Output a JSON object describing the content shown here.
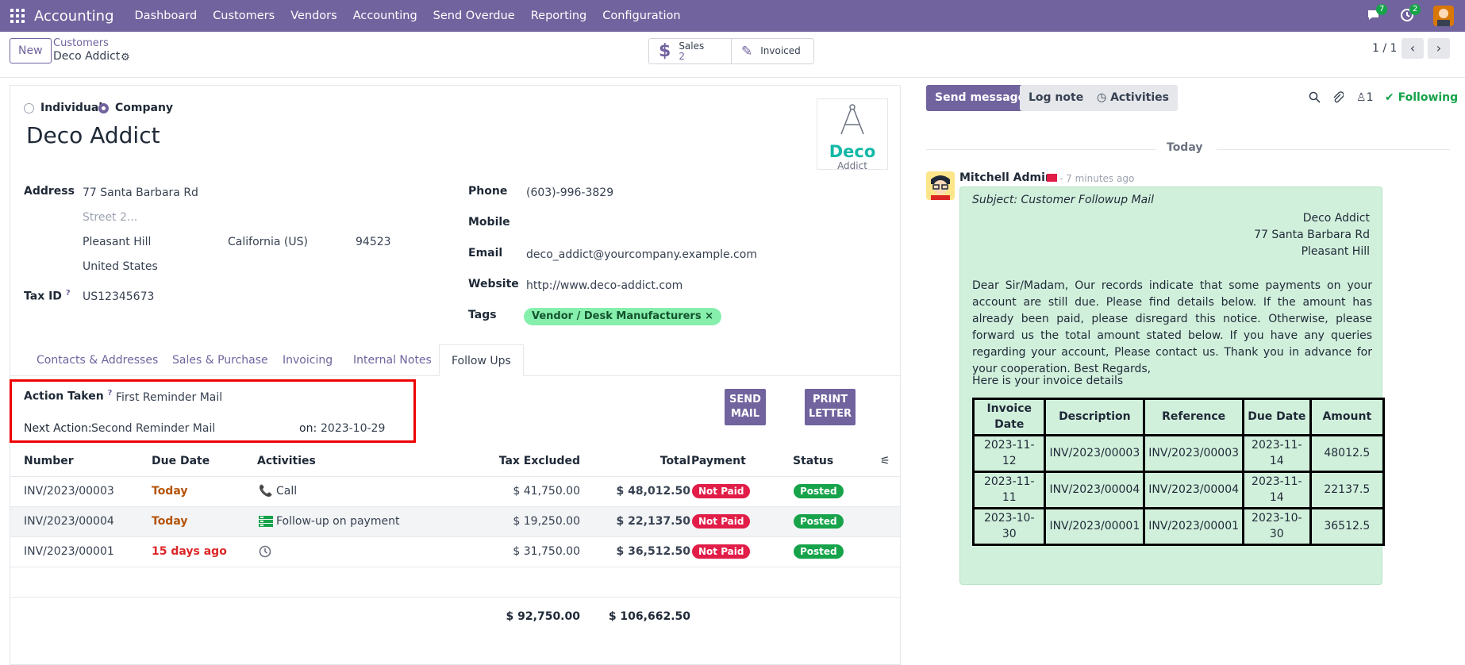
{
  "topnav": {
    "brand": "Accounting",
    "menu": [
      "Dashboard",
      "Customers",
      "Vendors",
      "Accounting",
      "Send Overdue",
      "Reporting",
      "Configuration"
    ],
    "messages_count": "7",
    "activities_count": "2"
  },
  "control_panel": {
    "new_label": "New",
    "breadcrumb_parent": "Customers",
    "breadcrumb_current": "Deco Addict",
    "sales_label": "Sales",
    "sales_count": "2",
    "invoiced_label": "Invoiced",
    "pager": "1 / 1"
  },
  "form": {
    "radio_individual": "Individual",
    "radio_company": "Company",
    "name": "Deco Addict",
    "logo_top": "Deco",
    "logo_bottom": "Addict",
    "address_label": "Address",
    "street": "77 Santa Barbara Rd",
    "street2_placeholder": "Street 2...",
    "city": "Pleasant Hill",
    "state": "California (US)",
    "zip": "94523",
    "country": "United States",
    "tax_id_label": "Tax ID",
    "tax_id": "US12345673",
    "phone_label": "Phone",
    "phone": "(603)-996-3829",
    "mobile_label": "Mobile",
    "email_label": "Email",
    "email": "deco_addict@yourcompany.example.com",
    "website_label": "Website",
    "website": "http://www.deco-addict.com",
    "tags_label": "Tags",
    "tag": "Vendor / Desk Manufacturers",
    "tabs": [
      "Contacts & Addresses",
      "Sales & Purchase",
      "Invoicing",
      "Internal Notes",
      "Follow Ups"
    ]
  },
  "followup": {
    "action_taken_label": "Action Taken",
    "action_taken": "First Reminder Mail",
    "next_action_label": "Next Action:",
    "next_action": "Second Reminder Mail",
    "on_label": "on:",
    "on_date": "2023-10-29",
    "send_mail_1": "SEND",
    "send_mail_2": "MAIL",
    "print_letter_1": "PRINT",
    "print_letter_2": "LETTER"
  },
  "invoices": {
    "headers": [
      "Number",
      "Due Date",
      "Activities",
      "Tax Excluded",
      "Total",
      "Payment",
      "Status"
    ],
    "rows": [
      {
        "number": "INV/2023/00003",
        "due": "Today",
        "activity": "Call",
        "tax_excl": "$ 41,750.00",
        "total": "$ 48,012.50",
        "payment": "Not Paid",
        "status": "Posted"
      },
      {
        "number": "INV/2023/00004",
        "due": "Today",
        "activity": "Follow-up on payment",
        "tax_excl": "$ 19,250.00",
        "total": "$ 22,137.50",
        "payment": "Not Paid",
        "status": "Posted"
      },
      {
        "number": "INV/2023/00001",
        "due": "15 days ago",
        "activity": "",
        "tax_excl": "$ 31,750.00",
        "total": "$ 36,512.50",
        "payment": "Not Paid",
        "status": "Posted"
      }
    ],
    "sum_tax_excl": "$ 92,750.00",
    "sum_total": "$ 106,662.50"
  },
  "chatter": {
    "send_message": "Send message",
    "log_note": "Log note",
    "activities": "Activities",
    "followers_count": "1",
    "following": "Following",
    "today": "Today",
    "author": "Mitchell Admin",
    "when": "- 7 minutes ago",
    "subject": "Subject: Customer Followup Mail",
    "address_lines": [
      "Deco Addict",
      "77 Santa Barbara Rd",
      "Pleasant Hill"
    ],
    "body": "Dear Sir/Madam, Our records indicate that some payments on your account are still due. Please find details below. If the amount has already been paid, please disregard this notice. Otherwise, please forward us the total amount stated below. If you have any queries regarding your account, Please contact us. Thank you in advance for your cooperation. Best Regards,",
    "invoice_intro": "Here is your invoice details",
    "table_headers": [
      "Invoice Date",
      "Description",
      "Reference",
      "Due Date",
      "Amount"
    ],
    "table_rows": [
      [
        "2023-11-12",
        "INV/2023/00003",
        "INV/2023/00003",
        "2023-11-14",
        "48012.5"
      ],
      [
        "2023-11-11",
        "INV/2023/00004",
        "INV/2023/00004",
        "2023-11-14",
        "22137.5"
      ],
      [
        "2023-10-30",
        "INV/2023/00001",
        "INV/2023/00001",
        "2023-10-30",
        "36512.5"
      ]
    ]
  },
  "colors": {
    "brand": "#71639e",
    "highlight": "#ee0000",
    "not_paid": "#e11d48",
    "posted": "#16a34a",
    "bubble": "#d1f0dc"
  }
}
